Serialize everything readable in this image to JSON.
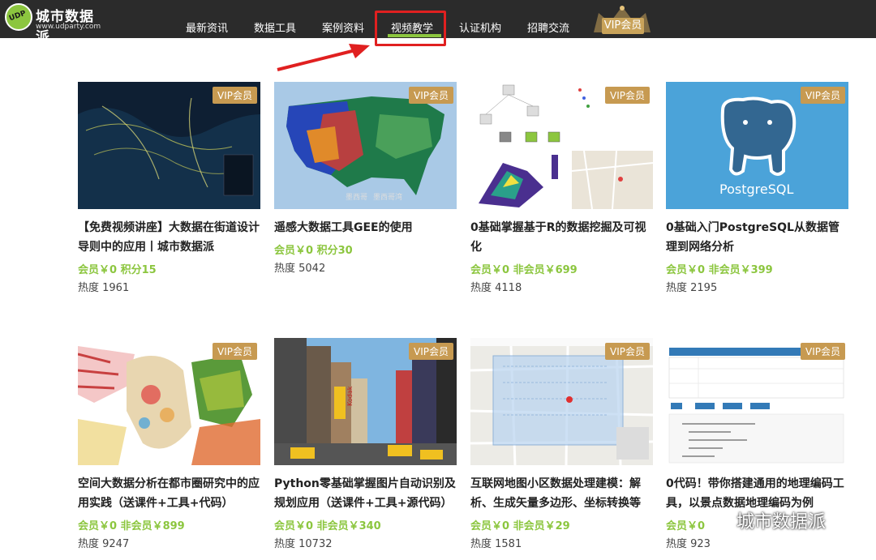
{
  "brand": {
    "name": "城市数据派",
    "url": "www.udparty.com",
    "badge": "UDP"
  },
  "nav": {
    "items": [
      "最新资讯",
      "数据工具",
      "案例资料",
      "视频教学",
      "认证机构",
      "招聘交流"
    ],
    "vip": "VIP会员",
    "active": "视频教学"
  },
  "colors": {
    "accent": "#8cc63f",
    "header": "#2b2b2b",
    "vip": "#c79a51",
    "annotation": "#e02020"
  },
  "cards": [
    {
      "badge": "VIP会员",
      "title": "【免费视频讲座】大数据在街道设计导则中的应用丨城市数据派",
      "price": "会员￥0  积分15",
      "heat": "热度 1961"
    },
    {
      "badge": "VIP会员",
      "title": "遥感大数据工具GEE的使用",
      "price": "会员￥0  积分30",
      "heat": "热度 5042"
    },
    {
      "badge": "VIP会员",
      "title": "0基础掌握基于R的数据挖掘及可视化",
      "price": "会员￥0  非会员￥699",
      "heat": "热度 4118"
    },
    {
      "badge": "VIP会员",
      "title": "0基础入门PostgreSQL从数据管理到网络分析",
      "price": "会员￥0  非会员￥399",
      "heat": "热度 2195"
    },
    {
      "badge": "VIP会员",
      "title": "空间大数据分析在都市圈研究中的应用实践（送课件+工具+代码）",
      "price": "会员￥0  非会员￥899",
      "heat": "热度 9247"
    },
    {
      "badge": "VIP会员",
      "title": "Python零基础掌握图片自动识别及规划应用（送课件+工具+源代码）",
      "price": "会员￥0  非会员￥340",
      "heat": "热度 10732"
    },
    {
      "badge": "VIP会员",
      "title": "互联网地图小区数据处理建模：解析、生成矢量多边形、坐标转换等",
      "price": "会员￥0  非会员￥29",
      "heat": "热度 1581"
    },
    {
      "badge": "VIP会员",
      "title": "0代码！带你搭建通用的地理编码工具，以景点数据地理编码为例",
      "price": "会员￥0",
      "heat": "热度 923"
    }
  ],
  "thumb_text": {
    "postgres": "PostgreSQL",
    "mexico": "墨西哥",
    "gulf": "墨西哥湾",
    "kodak": "Kodak"
  },
  "watermark": "城市数据派"
}
